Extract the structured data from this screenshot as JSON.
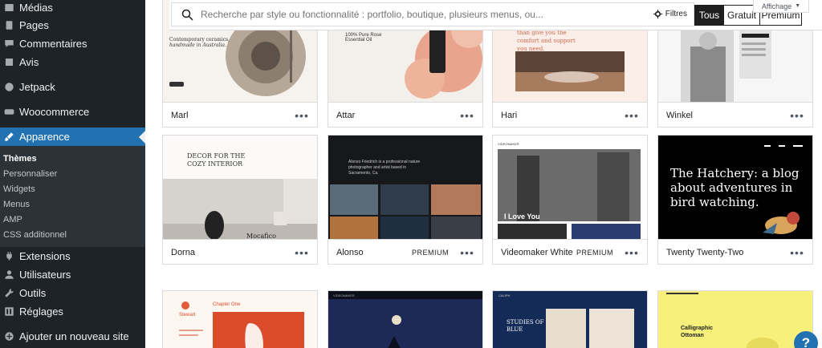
{
  "sidebar": {
    "items": [
      {
        "label": "Médias",
        "icon": "media-icon"
      },
      {
        "label": "Pages",
        "icon": "pages-icon"
      },
      {
        "label": "Commentaires",
        "icon": "comments-icon"
      },
      {
        "label": "Avis",
        "icon": "feedback-icon"
      },
      {
        "label": "Jetpack",
        "icon": "jetpack-icon"
      },
      {
        "label": "Woocommerce",
        "icon": "woocommerce-icon"
      },
      {
        "label": "Apparence",
        "icon": "brush-icon"
      },
      {
        "label": "Extensions",
        "icon": "plugins-icon"
      },
      {
        "label": "Utilisateurs",
        "icon": "users-icon"
      },
      {
        "label": "Outils",
        "icon": "tools-icon"
      },
      {
        "label": "Réglages",
        "icon": "settings-icon"
      },
      {
        "label": "Ajouter un nouveau site",
        "icon": "add-site-icon"
      }
    ],
    "submenu": [
      "Thèmes",
      "Personnaliser",
      "Widgets",
      "Menus",
      "AMP",
      "CSS additionnel"
    ],
    "active_color": "#2271b1"
  },
  "search": {
    "placeholder": "Recherche par style ou fonctionnalité : portfolio, boutique, plusieurs menus, ou...",
    "filters_label": "Filtres"
  },
  "tabs": {
    "all": "Tous",
    "free": "Gratuit",
    "premium": "Premium"
  },
  "view_dropdown": "Affichage",
  "themes": [
    {
      "name": "Marl",
      "premium": false,
      "thumb": {
        "line1": "Contemporary ceramics,",
        "line2": "handmade in Australia."
      }
    },
    {
      "name": "Attar",
      "premium": false,
      "thumb": {
        "line1": "100% Pure Rose",
        "line2": "Essential Oil"
      }
    },
    {
      "name": "Hari",
      "premium": false,
      "thumb": {
        "line1": "than give you the",
        "line2": "comfort and support",
        "line3": "you need."
      }
    },
    {
      "name": "Winkel",
      "premium": false,
      "thumb": {}
    },
    {
      "name": "Dorna",
      "premium": false,
      "thumb": {
        "line1": "DECOR FOR THE",
        "line2": "COZY INTERIOR",
        "brand": "Mocafico"
      }
    },
    {
      "name": "Alonso",
      "premium": true,
      "thumb": {
        "line1": "Alonso Friedrich is a professional nature",
        "line2": "photographer and artist based in",
        "line3": "Sacramento, Ca."
      }
    },
    {
      "name": "Videomaker White",
      "premium": true,
      "thumb": {
        "brand": "VIDEOMAKER",
        "headline": "I Love You"
      }
    },
    {
      "name": "Twenty Twenty-Two",
      "premium": false,
      "thumb": {
        "line1": "The Hatchery: a blog",
        "line2": "about adventures in",
        "line3": "bird watching."
      }
    },
    {
      "name": "",
      "premium": false,
      "thumb": {
        "brand": "Stewart",
        "chapter": "Chapter One"
      }
    },
    {
      "name": "",
      "premium": false,
      "thumb": {
        "brand": "VIDEOMAKER"
      }
    },
    {
      "name": "",
      "premium": false,
      "thumb": {
        "brand": "CALIPH",
        "line1": "STUDIES OF",
        "line2": "BLUE"
      }
    },
    {
      "name": "",
      "premium": false,
      "thumb": {
        "line1": "Calligraphic",
        "line2": "Ottoman"
      }
    }
  ],
  "premium_badge": "PREMIUM",
  "more_glyph": "•••",
  "help_label": "?"
}
